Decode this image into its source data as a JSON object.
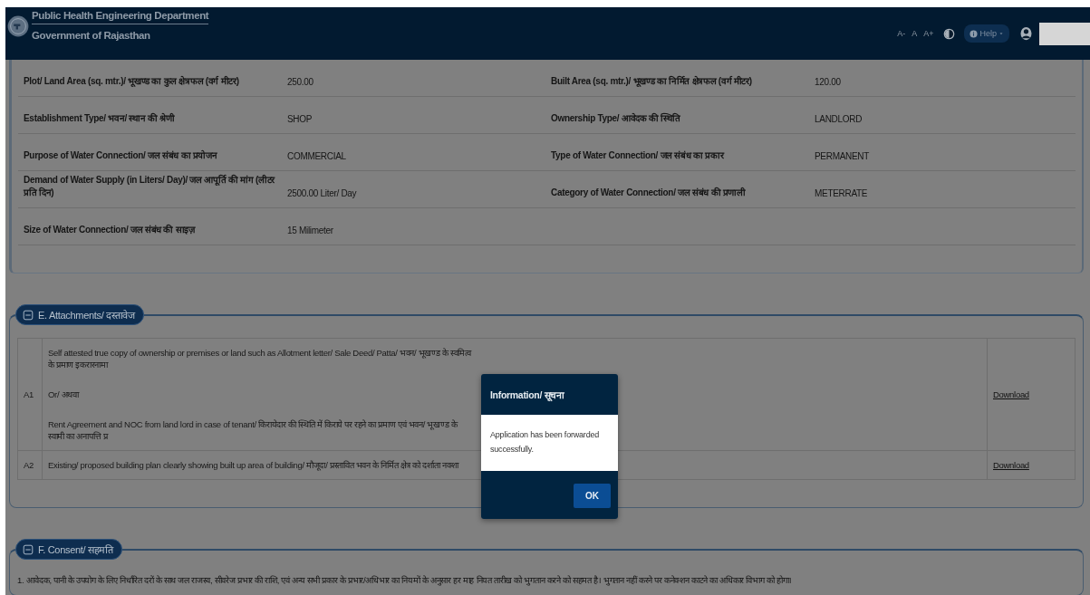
{
  "header": {
    "title": "Public Health Engineering Department",
    "subtitle": "Government of Rajasthan",
    "font_controls": [
      "A-",
      "A",
      "A+"
    ],
    "help_button": "Help"
  },
  "details": {
    "fields": [
      {
        "label": "Plot/ Land Area (sq. mtr.)/ भूखण्ड का कुल क्षेत्रफल (वर्ग मीटर)",
        "value": "250.00"
      },
      {
        "label": "Built Area (sq. mtr.)/ भूखण्ड का निर्मित क्षेत्रफल (वर्ग मीटर)",
        "value": "120.00"
      },
      {
        "label": "Establishment Type/ भवन/ स्थान की श्रेणी",
        "value": "SHOP"
      },
      {
        "label": "Ownership Type/ आवेदक की स्थिति",
        "value": "LANDLORD"
      },
      {
        "label": "Purpose of Water Connection/ जल संबंध का प्रयोजन",
        "value": "COMMERCIAL"
      },
      {
        "label": "Type of Water Connection/ जल संबंध का प्रकार",
        "value": "PERMANENT"
      },
      {
        "label": "Demand of Water Supply (in Liters/ Day)/ जल आपूर्ति की मांग (लीटर प्रति दिन)",
        "value": "2500.00 Liter/ Day"
      },
      {
        "label": "Category of Water Connection/ जल संबंध की प्रणाली",
        "value": "METERRATE"
      },
      {
        "label": "Size of Water Connection/ जल संबंध की साइज़",
        "value": "15 Milimeter"
      }
    ]
  },
  "attachments": {
    "title": "E. Attachments/ दस्तावेज",
    "rows": [
      {
        "code": "A1",
        "lines": [
          "Self attested true copy of ownership or premises or land such as Allotment letter/ Sale Deed/ Patta/ भवन/ भूखण्ड के स्वमित्व के प्रमाण इकरारनामा",
          "Or/ अथवा",
          "Rent Agreement and NOC from land lord in case of tenant/ किरायेदार की स्थिति में किराये पर रहने का प्रमाण एवं भवन/ भूखण्ड के स्वामी का अनापत्ति प्र"
        ],
        "link": "Download"
      },
      {
        "code": "A2",
        "lines": [
          "Existing/ proposed building plan clearly showing built up area of building/ मौजूदा/ प्रस्तावित भवन के निर्मित क्षेत्र को दर्शाता नक्शा"
        ],
        "link": "Download"
      }
    ]
  },
  "consent": {
    "title": "F. Consent/ सहमति",
    "items": [
      "1. आवेदक, पानी के उपयोग के लिए निर्धारित दरों के साथ जल राजस्व, सीवरेज प्रभार की राशि, एवं अन्य सभी प्रकार के प्रभार/अधिभार का नियमों के अनुसार हर माह नियत तारीख को भुगतान करने को सहमत है। भुगतान नहीं करने पर कनेक्शन काटने का अधिकार विभाग को होगा।"
    ]
  },
  "dialog": {
    "title": "Information/ सूचना",
    "message": "Application has been forwarded successfully.",
    "button": "OK"
  }
}
